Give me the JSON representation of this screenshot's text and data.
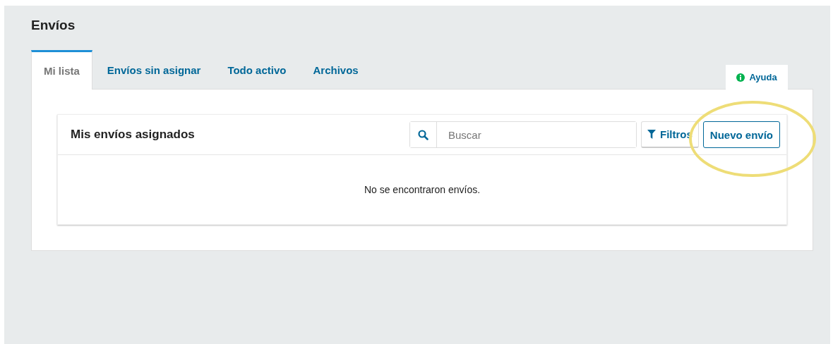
{
  "page_title": "Envíos",
  "tabs": [
    {
      "label": "Mi lista",
      "selected": true
    },
    {
      "label": "Envíos sin asignar",
      "selected": false
    },
    {
      "label": "Todo activo",
      "selected": false
    },
    {
      "label": "Archivos",
      "selected": false
    }
  ],
  "help_tab": {
    "label": "Ayuda"
  },
  "list": {
    "title": "Mis envíos asignados",
    "search": {
      "placeholder": "Buscar"
    },
    "filter_button": "Filtros",
    "new_button": "Nuevo envío",
    "empty_message": "No se encontraron envíos."
  }
}
